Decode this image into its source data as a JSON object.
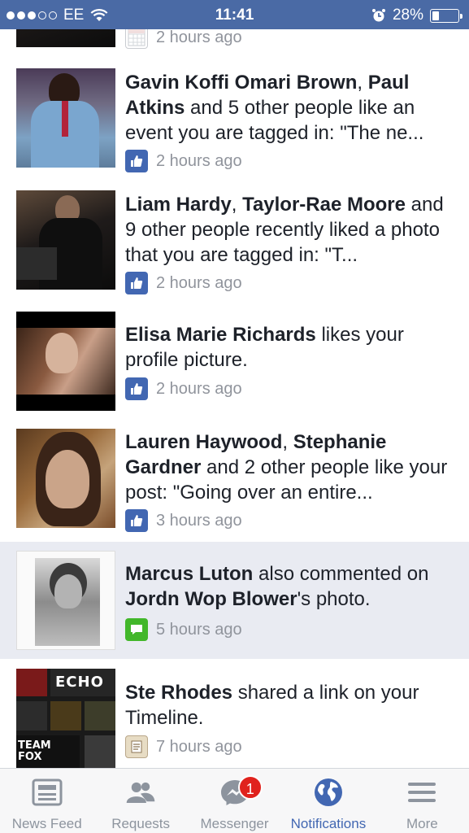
{
  "status_bar": {
    "carrier": "EE",
    "time": "11:41",
    "battery_percent": "28%",
    "battery_level": 0.28,
    "signal_bars_filled": 3,
    "signal_bars_total": 5
  },
  "notifications": [
    {
      "segments": [],
      "time": "2 hours ago",
      "icon": "calendar-icon"
    },
    {
      "segments": [
        {
          "text": "Gavin Koffi Omari Brown",
          "bold": true
        },
        {
          "text": ", ",
          "bold": false
        },
        {
          "text": "Paul Atkins",
          "bold": true
        },
        {
          "text": " and 5 other people like an event you are tagged in: \"The ne...",
          "bold": false
        }
      ],
      "time": "2 hours ago",
      "icon": "like-icon"
    },
    {
      "segments": [
        {
          "text": "Liam Hardy",
          "bold": true
        },
        {
          "text": ", ",
          "bold": false
        },
        {
          "text": "Taylor-Rae Moore",
          "bold": true
        },
        {
          "text": " and 9 other people recently liked a photo that you are tagged in: \"T...",
          "bold": false
        }
      ],
      "time": "2 hours ago",
      "icon": "like-icon"
    },
    {
      "segments": [
        {
          "text": "Elisa Marie Richards",
          "bold": true
        },
        {
          "text": " likes your profile picture.",
          "bold": false
        }
      ],
      "time": "2 hours ago",
      "icon": "like-icon"
    },
    {
      "segments": [
        {
          "text": "Lauren Haywood",
          "bold": true
        },
        {
          "text": ", ",
          "bold": false
        },
        {
          "text": "Stephanie Gardner",
          "bold": true
        },
        {
          "text": " and 2 other people like your post: \"Going over an entire...",
          "bold": false
        }
      ],
      "time": "3 hours ago",
      "icon": "like-icon"
    },
    {
      "segments": [
        {
          "text": "Marcus Luton",
          "bold": true
        },
        {
          "text": " also commented on ",
          "bold": false
        },
        {
          "text": "Jordn Wop Blower",
          "bold": true
        },
        {
          "text": "'s photo.",
          "bold": false
        }
      ],
      "time": "5 hours ago",
      "icon": "comment-icon"
    },
    {
      "segments": [
        {
          "text": "Ste Rhodes",
          "bold": true
        },
        {
          "text": " shared a link on your Timeline.",
          "bold": false
        }
      ],
      "time": "7 hours ago",
      "icon": "link-icon"
    }
  ],
  "collage_text": {
    "echo": "ECHO",
    "team_fox": "TEAM FOX"
  },
  "tab_bar": {
    "tabs": [
      {
        "label": "News Feed",
        "icon": "news-feed-icon"
      },
      {
        "label": "Requests",
        "icon": "friend-requests-icon"
      },
      {
        "label": "Messenger",
        "icon": "messenger-icon",
        "badge": "1"
      },
      {
        "label": "Notifications",
        "icon": "globe-icon"
      },
      {
        "label": "More",
        "icon": "menu-icon"
      }
    ]
  },
  "colors": {
    "status_bar": "#4a6aa5",
    "accent": "#4267b2",
    "highlight_row": "#e9ebf2",
    "badge": "#e0221d"
  }
}
